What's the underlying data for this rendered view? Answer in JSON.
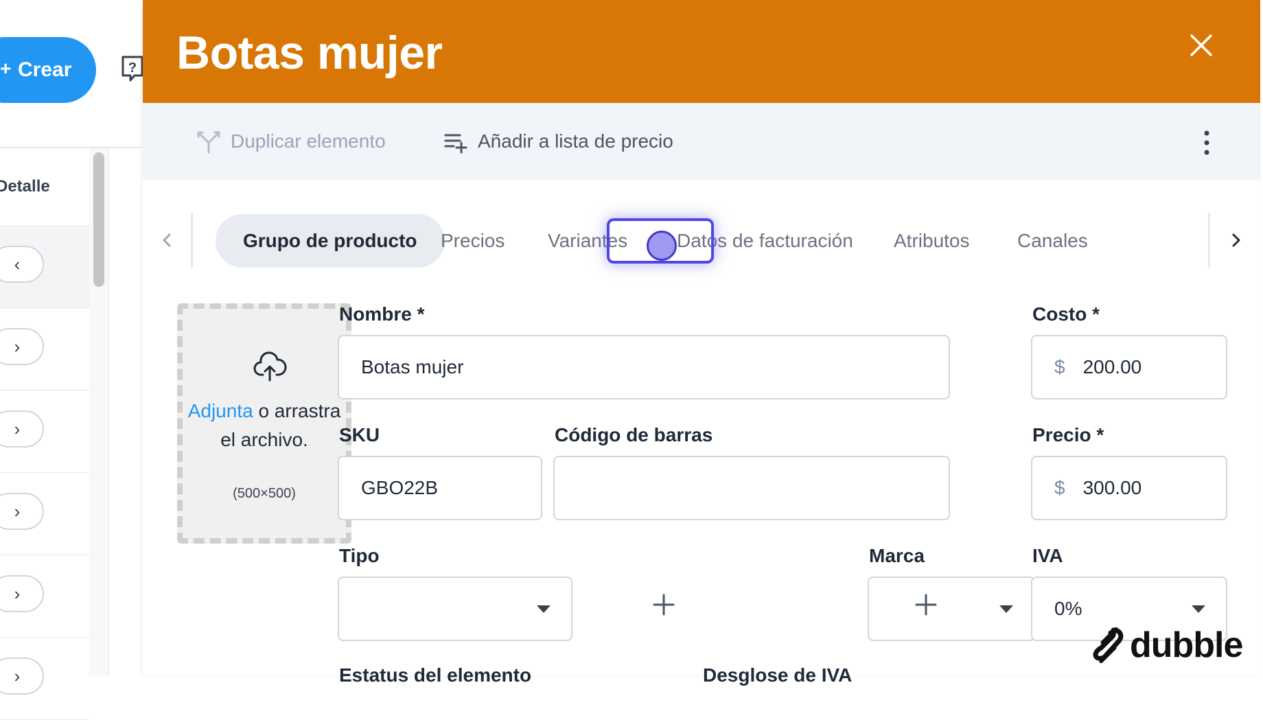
{
  "background_app": {
    "create_label": "Crear",
    "list_header": "Detalle"
  },
  "drawer": {
    "title": "Botas mujer",
    "header_color": "#d97706",
    "toolbar": {
      "duplicate_label": "Duplicar elemento",
      "add_pricelist_label": "Añadir a lista de precio"
    },
    "tabs": [
      {
        "label": "Grupo de producto",
        "active": true
      },
      {
        "label": "Precios",
        "active": false
      },
      {
        "label": "Variantes",
        "active": false
      },
      {
        "label": "Datos de facturación",
        "active": false
      },
      {
        "label": "Atributos",
        "active": false
      },
      {
        "label": "Canales",
        "active": false
      }
    ],
    "upload": {
      "link_text": "Adjunta",
      "text_after_link": " o arrastra el archivo.",
      "dimensions": "(500×500)"
    },
    "form": {
      "name_label": "Nombre *",
      "name_value": "Botas mujer",
      "cost_label": "Costo *",
      "cost_currency": "$",
      "cost_value": "200.00",
      "sku_label": "SKU",
      "sku_value": "GBO22B",
      "barcode_label": "Código de barras",
      "barcode_value": "",
      "price_label": "Precio *",
      "price_currency": "$",
      "price_value": "300.00",
      "type_label": "Tipo",
      "type_value": "",
      "brand_label": "Marca",
      "brand_value": "",
      "iva_label": "IVA",
      "iva_value": "0%",
      "status_label": "Estatus del elemento",
      "iva_breakdown_label": "Desglose de IVA"
    }
  },
  "watermark": "dubble"
}
